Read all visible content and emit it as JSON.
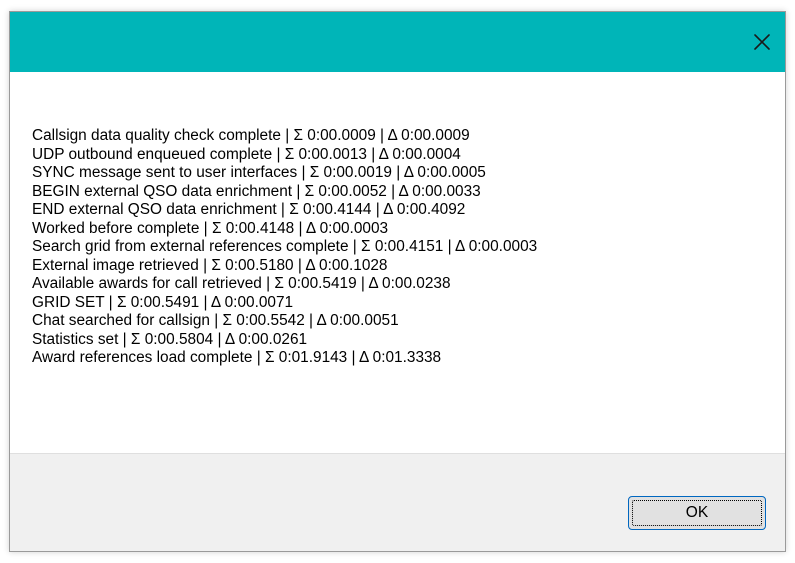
{
  "window": {
    "title": "",
    "accent_color": "#00b5b8",
    "close_icon": "close-icon"
  },
  "log_lines": [
    "Callsign data quality check complete | Σ 0:00.0009 | Δ 0:00.0009",
    "UDP outbound enqueued complete | Σ 0:00.0013 | Δ 0:00.0004",
    "SYNC message sent to user interfaces | Σ 0:00.0019 | Δ 0:00.0005",
    "BEGIN external QSO data enrichment | Σ 0:00.0052 | Δ 0:00.0033",
    "END external QSO data enrichment | Σ 0:00.4144 | Δ 0:00.4092",
    "Worked before complete | Σ 0:00.4148 | Δ 0:00.0003",
    "Search grid from external references complete | Σ 0:00.4151 | Δ 0:00.0003",
    "External image retrieved | Σ 0:00.5180 | Δ 0:00.1028",
    "Available awards for call retrieved | Σ 0:00.5419 | Δ 0:00.0238",
    "GRID SET | Σ 0:00.5491 | Δ 0:00.0071",
    "Chat searched for callsign | Σ 0:00.5542 | Δ 0:00.0051",
    "Statistics set | Σ 0:00.5804 | Δ 0:00.0261",
    "Award references load complete | Σ 0:01.9143 | Δ 0:01.3338"
  ],
  "footer": {
    "ok_label": "OK"
  }
}
